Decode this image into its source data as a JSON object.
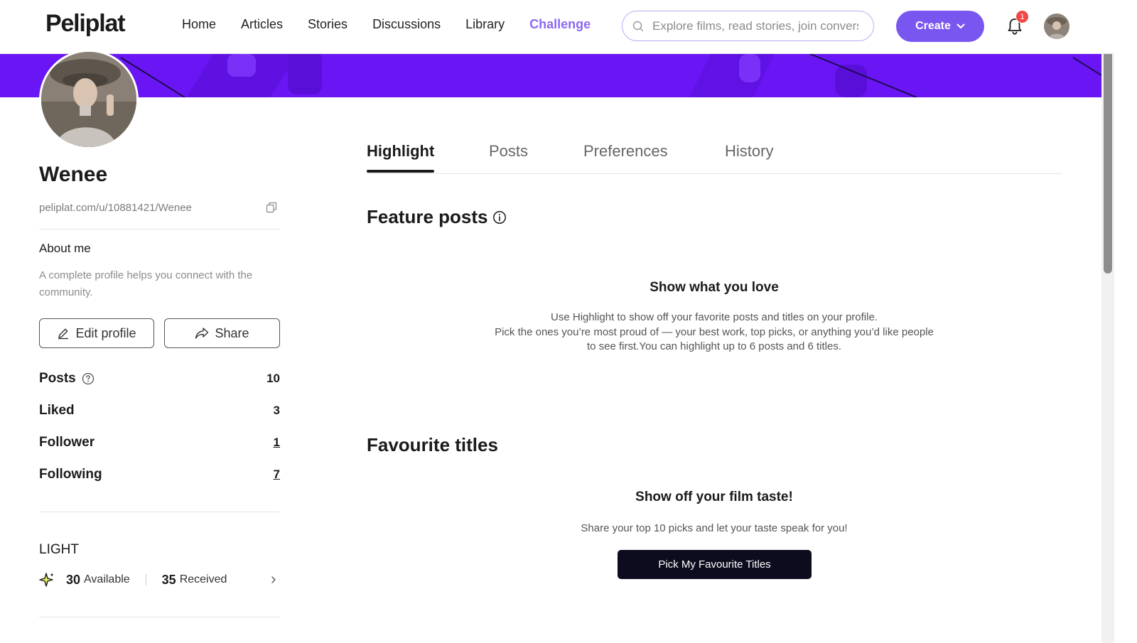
{
  "header": {
    "logo": "Peliplat",
    "nav": [
      "Home",
      "Articles",
      "Stories",
      "Discussions",
      "Library"
    ],
    "challenge": "Challenge",
    "search_placeholder": "Explore films, read stories, join conversations",
    "create_label": "Create",
    "notification_count": "1"
  },
  "profile": {
    "username": "Wenee",
    "url": "peliplat.com/u/10881421/Wenee",
    "about_title": "About me",
    "about_text": "A complete profile helps you connect with the community.",
    "edit_label": "Edit profile",
    "share_label": "Share",
    "stats": [
      {
        "label": "Posts",
        "value": "10"
      },
      {
        "label": "Liked",
        "value": "3"
      },
      {
        "label": "Follower",
        "value": "1"
      },
      {
        "label": "Following",
        "value": "7"
      }
    ],
    "light": {
      "title": "LIGHT",
      "available_value": "30",
      "available_label": "Available",
      "received_value": "35",
      "received_label": "Received"
    }
  },
  "tabs": [
    "Highlight",
    "Posts",
    "Preferences",
    "History"
  ],
  "feature": {
    "title": "Feature posts",
    "empty_title": "Show what you love",
    "empty_desc_1": "Use Highlight to show off your favorite posts and titles on your profile.",
    "empty_desc_2": "Pick the ones you’re most proud of — your best work, top picks, or anything you’d like people",
    "empty_desc_3": "to see first.You can highlight up to 6 posts and 6 titles."
  },
  "favourites": {
    "title": "Favourite titles",
    "empty_title": "Show off your film taste!",
    "empty_desc": "Share your top 10 picks and let your taste speak for you!",
    "button": "Pick My Favourite Titles"
  },
  "colors": {
    "accent": "#7a56f0",
    "challenge": "#8b68f2",
    "banner": "#6a16f4",
    "badge": "#f04848",
    "button_dark": "#0c0c1e"
  }
}
